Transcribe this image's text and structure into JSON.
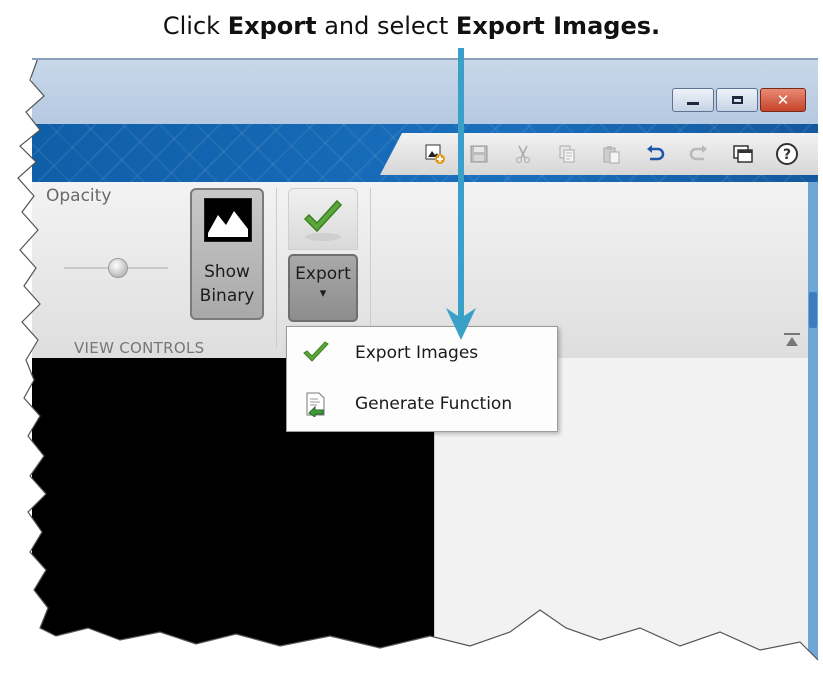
{
  "instruction": {
    "part1": "Click ",
    "bold1": "Export",
    "part2": " and select ",
    "bold2": "Export Images."
  },
  "window": {
    "controls": [
      {
        "icon": "minimize-icon"
      },
      {
        "icon": "maximize-icon"
      },
      {
        "icon": "close-icon",
        "glyph": "✕",
        "color": "#c4432a"
      }
    ]
  },
  "toolbar": {
    "accent": "#1a6fbd",
    "quick_access_icons": [
      "new-image-icon",
      "save-icon",
      "cut-icon",
      "copy-icon",
      "paste-icon",
      "undo-icon",
      "redo-icon",
      "layout-icon",
      "help-icon"
    ],
    "help_glyph": "?"
  },
  "ribbon": {
    "opacity_label": "Opacity",
    "show_binary_line1": "Show",
    "show_binary_line2": "Binary",
    "export_label": "Export",
    "export_caret": "▾",
    "section_label": "VIEW CONTROLS"
  },
  "menu": {
    "items": [
      {
        "label": "Export Images",
        "icon": "checkmark-icon"
      },
      {
        "label": "Generate Function",
        "icon": "generate-function-icon"
      }
    ]
  },
  "arrow_color": "#3aa0c8"
}
